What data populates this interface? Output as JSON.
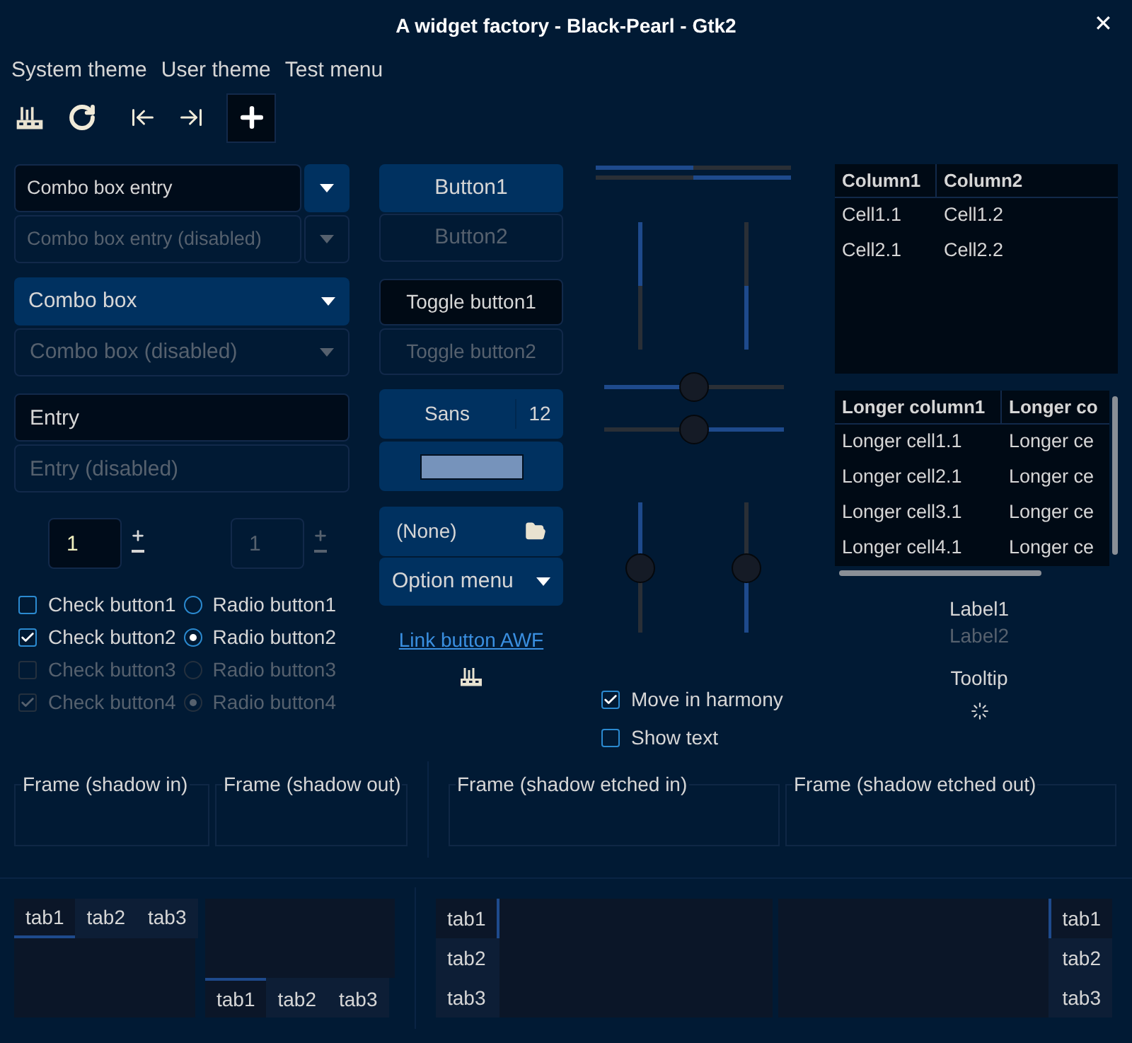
{
  "window": {
    "title": "A widget factory - Black-Pearl - Gtk2",
    "close": "✕"
  },
  "menubar": [
    "System theme",
    "User theme",
    "Test menu"
  ],
  "combos": [
    {
      "kind": "entry",
      "value": "Combo box entry",
      "disabled": false
    },
    {
      "kind": "entry",
      "value": "Combo box entry (disabled)",
      "disabled": true
    },
    {
      "kind": "combo",
      "value": "Combo box",
      "disabled": false
    },
    {
      "kind": "combo",
      "value": "Combo box (disabled)",
      "disabled": true
    }
  ],
  "entries": [
    {
      "value": "Entry",
      "disabled": false
    },
    {
      "value": "Entry (disabled)",
      "disabled": true
    }
  ],
  "spinbuttons": [
    {
      "value": "1",
      "disabled": false
    },
    {
      "value": "1",
      "disabled": true
    }
  ],
  "checks": [
    {
      "label": "Check button1",
      "checked": false,
      "disabled": false
    },
    {
      "label": "Check button2",
      "checked": true,
      "disabled": false
    },
    {
      "label": "Check button3",
      "checked": false,
      "disabled": true
    },
    {
      "label": "Check button4",
      "checked": true,
      "disabled": true
    }
  ],
  "radios": [
    {
      "label": "Radio button1",
      "selected": false,
      "disabled": false
    },
    {
      "label": "Radio button2",
      "selected": true,
      "disabled": false
    },
    {
      "label": "Radio button3",
      "selected": false,
      "disabled": true
    },
    {
      "label": "Radio button4",
      "selected": true,
      "disabled": true
    }
  ],
  "buttons": [
    {
      "label": "Button1",
      "disabled": false
    },
    {
      "label": "Button2",
      "disabled": true
    }
  ],
  "toggles": [
    {
      "label": "Toggle button1",
      "disabled": false
    },
    {
      "label": "Toggle button2",
      "disabled": true
    }
  ],
  "font_button": {
    "family": "Sans",
    "size": "12"
  },
  "color_button": {
    "color": "#7693bb"
  },
  "file_chooser": {
    "value": "(None)"
  },
  "option_menu": {
    "label": "Option menu"
  },
  "link": "Link button AWF",
  "progress": [
    {
      "kind": "left-to-right",
      "level": 0.5
    },
    {
      "kind": "right-to-left",
      "level": 0.5
    },
    {
      "kind": "top-to-bottom",
      "level": 0.5
    },
    {
      "kind": "bottom-to-top",
      "level": 0.5
    }
  ],
  "scales": [
    {
      "kind": "left-to-right",
      "level": 0.5
    },
    {
      "kind": "right-to-left",
      "level": 0.5
    },
    {
      "kind": "top-to-bottom",
      "level": 0.5
    },
    {
      "kind": "bottom-to-top",
      "level": 0.5
    }
  ],
  "options": [
    {
      "label": "Move in harmony",
      "checked": true
    },
    {
      "label": "Show text",
      "checked": false
    }
  ],
  "tree1": {
    "columns": [
      "Column1",
      "Column2"
    ],
    "rows": [
      [
        "Cell1.1",
        "Cell1.2"
      ],
      [
        "Cell2.1",
        "Cell2.2"
      ]
    ]
  },
  "tree2": {
    "columns": [
      "Longer column1",
      "Longer co"
    ],
    "rows": [
      [
        "Longer cell1.1",
        "Longer ce"
      ],
      [
        "Longer cell2.1",
        "Longer ce"
      ],
      [
        "Longer cell3.1",
        "Longer ce"
      ],
      [
        "Longer cell4.1",
        "Longer ce"
      ]
    ]
  },
  "labels": [
    {
      "text": "Label1",
      "disabled": false
    },
    {
      "text": "Label2",
      "disabled": true
    }
  ],
  "tooltip": "Tooltip",
  "frames": [
    {
      "label": "Frame (shadow in)"
    },
    {
      "label": "Frame (shadow out)"
    },
    {
      "label": "Frame (shadow etched in)"
    },
    {
      "label": "Frame (shadow etched out)"
    }
  ],
  "notebooks": [
    {
      "kind": "top",
      "tabs": [
        {
          "label": "tab1",
          "selected": true
        },
        {
          "label": "tab2",
          "selected": false
        },
        {
          "label": "tab3",
          "selected": false
        }
      ]
    },
    {
      "kind": "bottom",
      "tabs": [
        {
          "label": "tab1",
          "selected": true
        },
        {
          "label": "tab2",
          "selected": false
        },
        {
          "label": "tab3",
          "selected": false
        }
      ]
    },
    {
      "kind": "left",
      "tabs": [
        {
          "label": "tab1",
          "selected": true
        },
        {
          "label": "tab2",
          "selected": false
        },
        {
          "label": "tab3",
          "selected": false
        }
      ]
    },
    {
      "kind": "right",
      "tabs": [
        {
          "label": "tab1",
          "selected": true
        },
        {
          "label": "tab2",
          "selected": false
        },
        {
          "label": "tab3",
          "selected": false
        }
      ]
    }
  ]
}
